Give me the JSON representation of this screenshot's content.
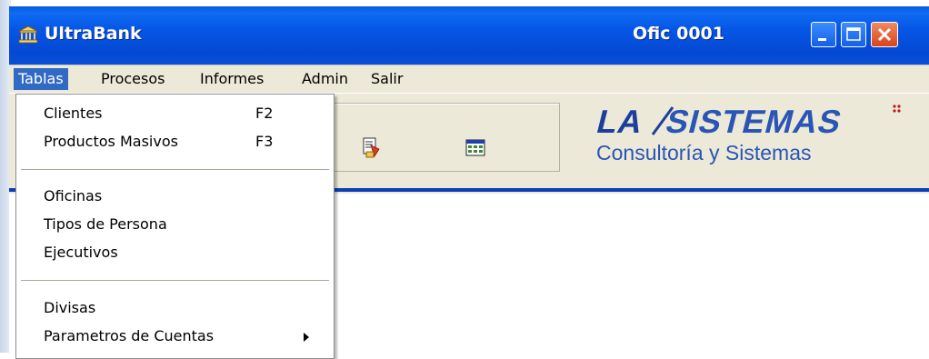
{
  "window": {
    "title": "UltraBank",
    "office": "Ofic 0001",
    "icon": "bank-icon",
    "title_bar_color": "#0656e6"
  },
  "title_buttons": {
    "minimize": "minimize-icon",
    "maximize": "maximize-icon",
    "close": "close-icon"
  },
  "menubar": {
    "items": [
      {
        "label": "Tablas",
        "active": true
      },
      {
        "label": "Procesos"
      },
      {
        "label": "Informes"
      },
      {
        "label": "Admin"
      },
      {
        "label": "Salir"
      }
    ],
    "highlight_color": "#316ac5"
  },
  "dropdown": {
    "groups": [
      [
        {
          "label": "Clientes",
          "shortcut": "F2"
        },
        {
          "label": "Productos Masivos",
          "shortcut": "F3"
        }
      ],
      [
        {
          "label": "Oficinas"
        },
        {
          "label": "Tipos de Persona"
        },
        {
          "label": "Ejecutivos"
        }
      ],
      [
        {
          "label": "Divisas"
        },
        {
          "label": "Parametros de Cuentas",
          "submenu": true
        }
      ]
    ]
  },
  "toolbar": {
    "icons": [
      "document-edit-icon",
      "window-calendar-icon"
    ]
  },
  "logo": {
    "line1": "LA SISTEMAS",
    "line2": "Consultoría y Sistemas",
    "line1_color": "#1d3f9c",
    "line2_color": "#2a55b5",
    "accent_color": "#c4161c"
  }
}
